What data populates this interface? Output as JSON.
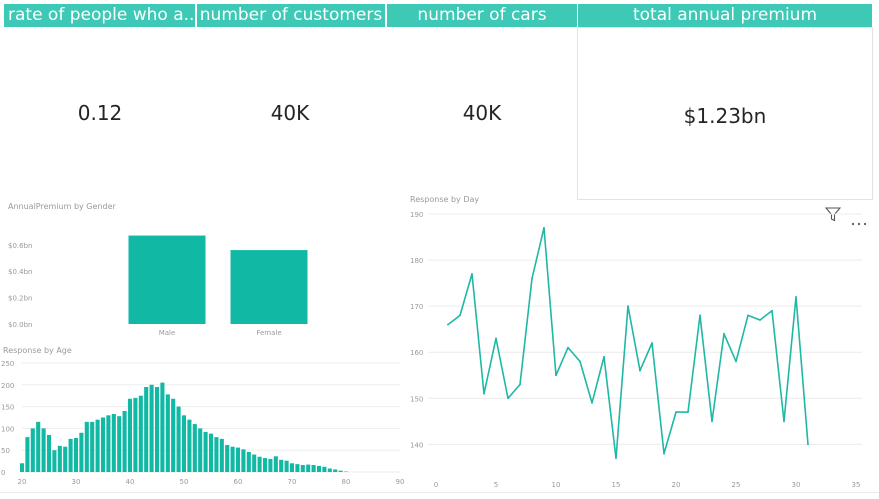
{
  "cards": [
    {
      "header": "rate of people who a...",
      "value": "0.12"
    },
    {
      "header": "number of customers",
      "value": "40K"
    },
    {
      "header": "number of cars",
      "value": "40K"
    },
    {
      "header": "total annual premium",
      "value": "$1.23bn"
    }
  ],
  "colors": {
    "accent": "#3dc9b6",
    "bar": "#11b9a5",
    "line": "#1fb8a5"
  },
  "icons": {
    "filter": "filter-icon",
    "more": "more-options-icon"
  },
  "chart_data": [
    {
      "type": "bar",
      "title": "AnnualPremium by Gender",
      "categories": [
        "Male",
        "Female"
      ],
      "values": [
        0.67,
        0.56
      ],
      "yticks": [
        "$0.6bn",
        "$0.4bn",
        "$0.2bn",
        "$0.0bn"
      ],
      "ylim": [
        0,
        0.75
      ]
    },
    {
      "type": "bar",
      "title": "Response by Age",
      "x": [
        20,
        21,
        22,
        23,
        24,
        25,
        26,
        27,
        28,
        29,
        30,
        31,
        32,
        33,
        34,
        35,
        36,
        37,
        38,
        39,
        40,
        41,
        42,
        43,
        44,
        45,
        46,
        47,
        48,
        49,
        50,
        51,
        52,
        53,
        54,
        55,
        56,
        57,
        58,
        59,
        60,
        61,
        62,
        63,
        64,
        65,
        66,
        67,
        68,
        69,
        70,
        71,
        72,
        73,
        74,
        75,
        76,
        77,
        78,
        79,
        80
      ],
      "values": [
        20,
        80,
        100,
        115,
        100,
        85,
        50,
        60,
        58,
        76,
        78,
        90,
        115,
        115,
        120,
        125,
        130,
        133,
        128,
        140,
        168,
        170,
        175,
        195,
        200,
        195,
        205,
        178,
        168,
        150,
        130,
        120,
        110,
        100,
        92,
        88,
        80,
        76,
        62,
        58,
        56,
        52,
        46,
        40,
        35,
        32,
        30,
        36,
        28,
        26,
        20,
        18,
        16,
        17,
        16,
        14,
        12,
        8,
        6,
        3,
        1
      ],
      "xticks": [
        "20",
        "30",
        "40",
        "50",
        "60",
        "70",
        "80",
        "90"
      ],
      "yticks": [
        "250",
        "200",
        "150",
        "100",
        "50",
        "0"
      ],
      "xlim": [
        20,
        90
      ],
      "ylim": [
        0,
        250
      ]
    },
    {
      "type": "line",
      "title": "Response by Day",
      "x": [
        1,
        2,
        3,
        4,
        5,
        6,
        7,
        8,
        9,
        10,
        11,
        12,
        13,
        14,
        15,
        16,
        17,
        18,
        19,
        20,
        21,
        22,
        23,
        24,
        25,
        26,
        27,
        28,
        29,
        30,
        31
      ],
      "values": [
        166,
        168,
        177,
        151,
        163,
        150,
        153,
        176,
        187,
        155,
        161,
        158,
        149,
        159,
        137,
        170,
        156,
        162,
        138,
        147,
        147,
        168,
        145,
        164,
        158,
        168,
        167,
        169,
        145,
        172,
        140
      ],
      "xticks": [
        "0",
        "5",
        "10",
        "15",
        "20",
        "25",
        "30",
        "35"
      ],
      "yticks": [
        "190",
        "180",
        "170",
        "160",
        "150",
        "140"
      ],
      "xlim": [
        0,
        35
      ],
      "ylim": [
        134,
        190
      ]
    }
  ]
}
